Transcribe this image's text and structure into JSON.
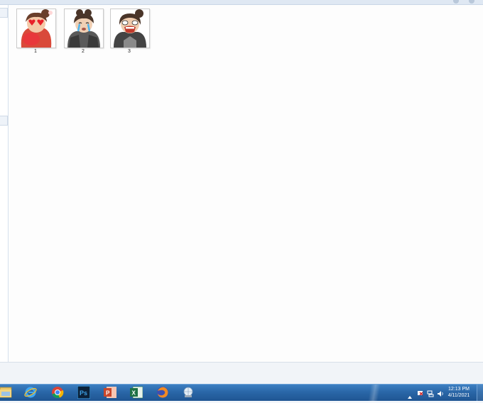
{
  "files": [
    {
      "name": "1",
      "icon": "emoji-hearts-thumbnail"
    },
    {
      "name": "2",
      "icon": "emoji-crying-thumbnail"
    },
    {
      "name": "3",
      "icon": "emoji-shouting-thumbnail"
    }
  ],
  "taskbar": {
    "apps": [
      {
        "name": "explorer",
        "icon": "folder-icon"
      },
      {
        "name": "internet-explorer",
        "icon": "ie-icon"
      },
      {
        "name": "chrome",
        "icon": "chrome-icon"
      },
      {
        "name": "photoshop",
        "icon": "photoshop-icon",
        "label": "Ps"
      },
      {
        "name": "powerpoint",
        "icon": "powerpoint-icon",
        "label": "P"
      },
      {
        "name": "excel",
        "icon": "excel-icon",
        "label": "X"
      },
      {
        "name": "firefox",
        "icon": "firefox-icon"
      },
      {
        "name": "network-app",
        "icon": "globe-app-icon"
      }
    ],
    "clock": {
      "time": "12:13 PM",
      "date": "4/11/2021"
    }
  },
  "colors": {
    "taskbar": "#2a67a8",
    "file_bg": "#fdfdfd",
    "nav_bg": "#ffffff"
  }
}
